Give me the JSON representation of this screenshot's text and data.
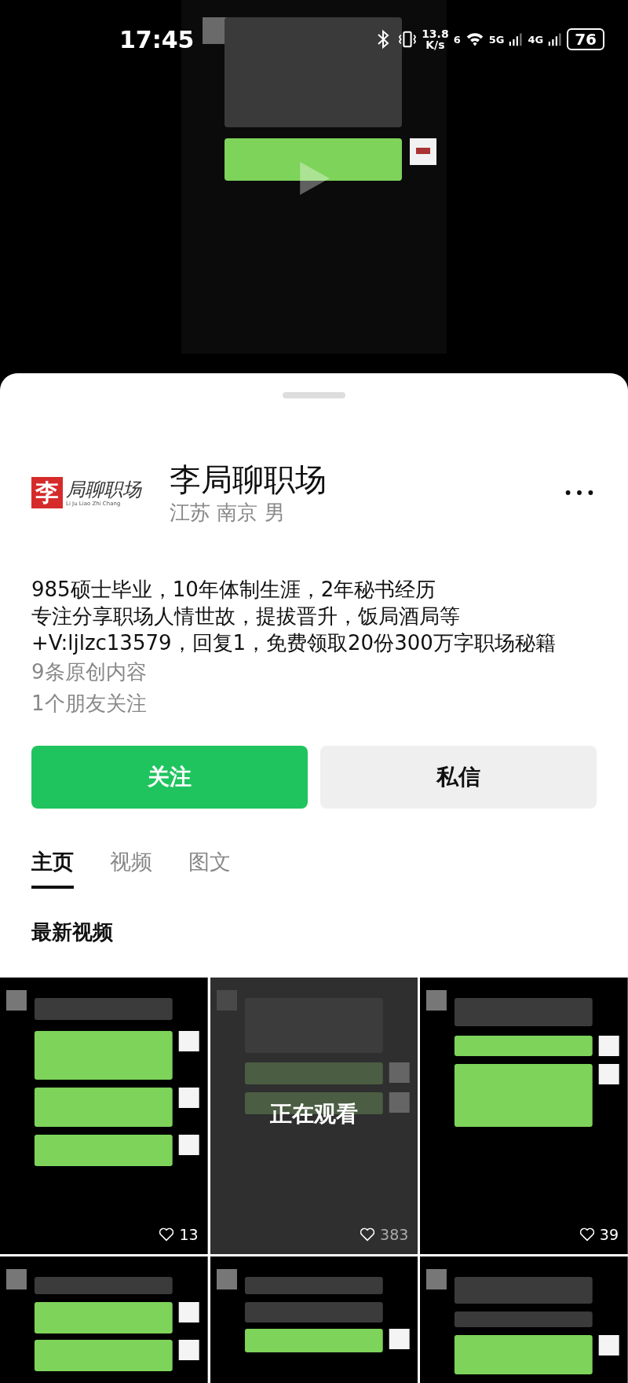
{
  "status_bar": {
    "time": "17:45",
    "net_speed": "13.8",
    "net_unit": "K/s",
    "wifi_label": "6",
    "signal_1": "5G",
    "signal_2": "4G",
    "battery": "76"
  },
  "video": {
    "kind": "picture"
  },
  "profile": {
    "logo": {
      "seal": "李",
      "title": "局聊职场",
      "pinyin": "Li Ju Liao Zhi Chang"
    },
    "name": "李局聊职场",
    "meta": "江苏 南京 男",
    "bio": [
      "985硕士毕业，10年体制生涯，2年秘书经历",
      "专注分享职场人情世故，提拔晋升，饭局酒局等",
      "+V:ljlzc13579，回复1，免费领取20份300万字职场秘籍"
    ],
    "stats": [
      "9条原创内容",
      "1个朋友关注"
    ]
  },
  "actions": [
    {
      "label": "关注",
      "kind": "primary"
    },
    {
      "label": "私信",
      "kind": "secondary"
    }
  ],
  "tabs": [
    {
      "label": "主页",
      "selected": true
    },
    {
      "label": "视频",
      "selected": false
    },
    {
      "label": "图文",
      "selected": false
    }
  ],
  "section_title": "最新视频",
  "videos": [
    {
      "kind": "picture",
      "likes": "13",
      "watching": false
    },
    {
      "kind": "picture",
      "likes": "383",
      "watching": true,
      "overlay": "正在观看"
    },
    {
      "kind": "picture",
      "likes": "39",
      "watching": false
    },
    {
      "kind": "picture",
      "watching": false
    },
    {
      "kind": "picture",
      "watching": false
    },
    {
      "kind": "picture",
      "watching": false
    }
  ]
}
